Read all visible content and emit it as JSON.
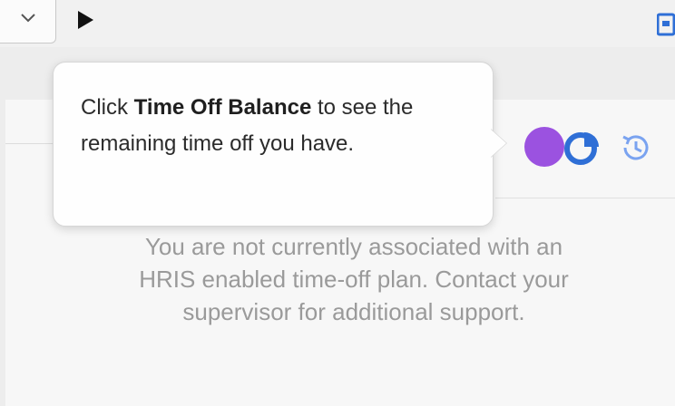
{
  "tooltip": {
    "prefix": "Click ",
    "highlight": "Time Off Balance",
    "suffix": " to see the remaining time off you have."
  },
  "notice": {
    "line1": "You are not currently associated with an",
    "line2": "HRIS enabled time-off plan. Contact your",
    "line3": "supervisor for additional support."
  },
  "icons": {
    "dropdown": "chevron-down-icon",
    "play": "play-icon",
    "corner": "export-icon",
    "pie": "pie-chart-icon",
    "history": "history-icon"
  },
  "colors": {
    "accent_purple": "#9b52e0",
    "icon_blue": "#2f6fd6",
    "history_blue": "#7aa3f0"
  }
}
